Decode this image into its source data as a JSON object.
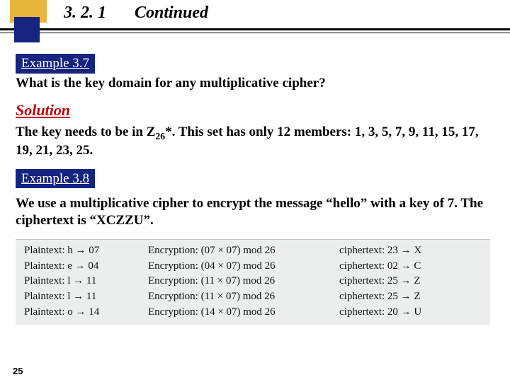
{
  "header": {
    "section": "3. 2. 1",
    "continued": "Continued"
  },
  "ex37": {
    "tag": "Example 3.7",
    "question": "What is the key domain for any multiplicative cipher?",
    "answer_html": "The key needs to be in Z<span class=\"sub\">26</span>*. This set has only 12 members: 1, 3, 5, 7, 9, 11, 15, 17, 19, 21, 23, 25."
  },
  "solution_label": "Solution",
  "ex38": {
    "tag": "Example 3.8",
    "text": "We use a multiplicative cipher to encrypt the message “hello” with a key of 7. The ciphertext is “XCZZU”."
  },
  "table": {
    "rows": [
      {
        "plain": "h",
        "pcode": "07",
        "enc": "(07 × 07) mod 26",
        "ccode": "23",
        "cipher": "X"
      },
      {
        "plain": "e",
        "pcode": "04",
        "enc": "(04 × 07) mod 26",
        "ccode": "02",
        "cipher": "C"
      },
      {
        "plain": "l",
        "pcode": "11",
        "enc": "(11 × 07) mod 26",
        "ccode": "25",
        "cipher": "Z"
      },
      {
        "plain": "l",
        "pcode": "11",
        "enc": "(11 × 07) mod 26",
        "ccode": "25",
        "cipher": "Z"
      },
      {
        "plain": "o",
        "pcode": "14",
        "enc": "(14 × 07) mod 26",
        "ccode": "20",
        "cipher": "U"
      }
    ]
  },
  "slide_number": "25"
}
